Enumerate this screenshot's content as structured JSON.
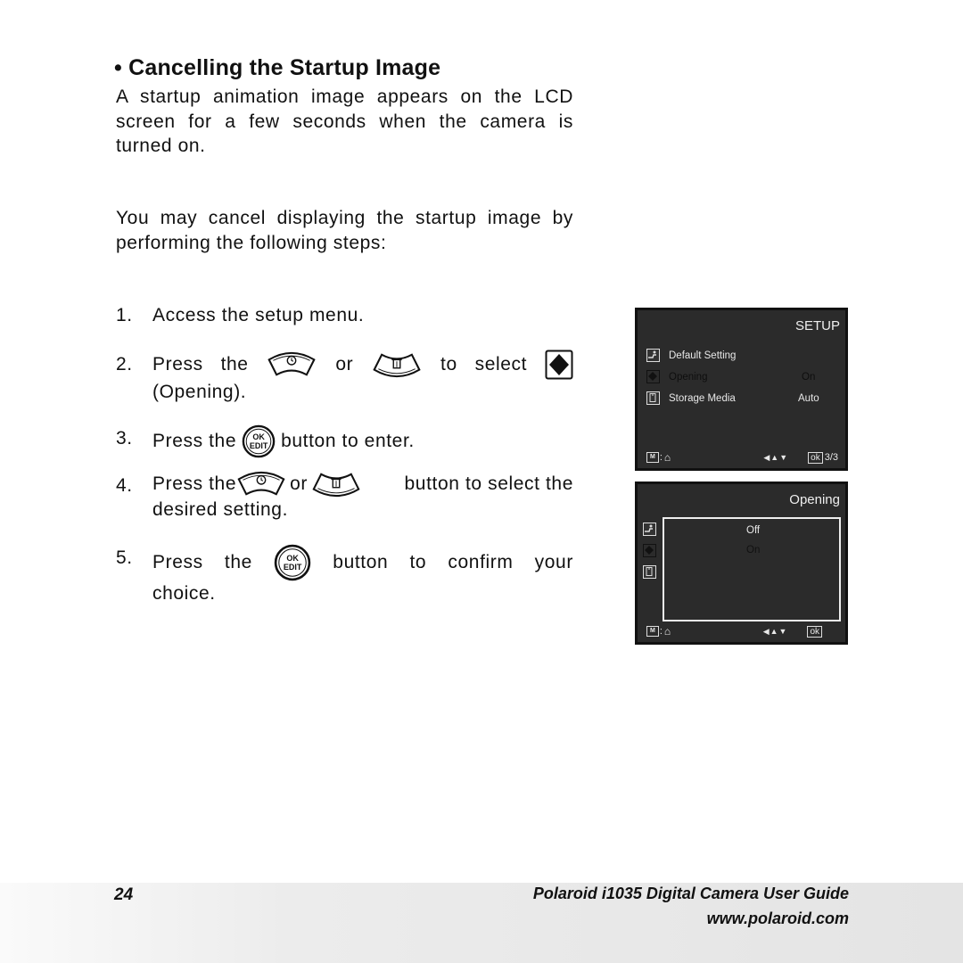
{
  "heading": "• Cancelling the Startup Image",
  "intro": "A startup animation image appears on the LCD screen for a few seconds when the camera is turned on.",
  "intro2": "You may cancel displaying the startup image by performing the following steps:",
  "steps": [
    {
      "num": "1.",
      "text": "Access the setup menu."
    },
    {
      "num": "2.",
      "w1": "Press",
      "w2": "the",
      "w3": "or",
      "w4": "to",
      "w5": "select",
      "line2": "(Opening)."
    },
    {
      "num": "3.",
      "pre": "Press the",
      "post": "button to enter."
    },
    {
      "num": "4.",
      "pre": "Press the",
      "mid": "or",
      "post": "button to select the",
      "line2": "desired setting."
    },
    {
      "num": "5.",
      "w1": "Press",
      "w2": "the",
      "w3": "button",
      "w4": "to",
      "w5": "confirm",
      "w6": "your",
      "line2": "choice."
    }
  ],
  "icons": {
    "up_button": "self-timer-up-button-icon",
    "down_button": "delete-down-button-icon",
    "ok_button": {
      "top": "OK",
      "bottom": "EDIT"
    },
    "opening": "opening-diamond-icon"
  },
  "lcd_setup": {
    "title": "SETUP",
    "items": [
      {
        "label": "Default Setting",
        "value": ""
      },
      {
        "label": "Opening",
        "value": "On"
      },
      {
        "label": "Storage Media",
        "value": "Auto"
      }
    ],
    "footer": {
      "m": "M",
      "nav": "◀▲▼",
      "ok": "ok",
      "page": "3/3"
    }
  },
  "lcd_opening": {
    "title": "Opening",
    "options": [
      "Off",
      "On"
    ],
    "footer": {
      "m": "M",
      "nav": "◀▲▼",
      "ok": "ok"
    }
  },
  "footer": {
    "page_number": "24",
    "guide_title": "Polaroid i1035 Digital Camera User Guide",
    "url": "www.polaroid.com"
  }
}
